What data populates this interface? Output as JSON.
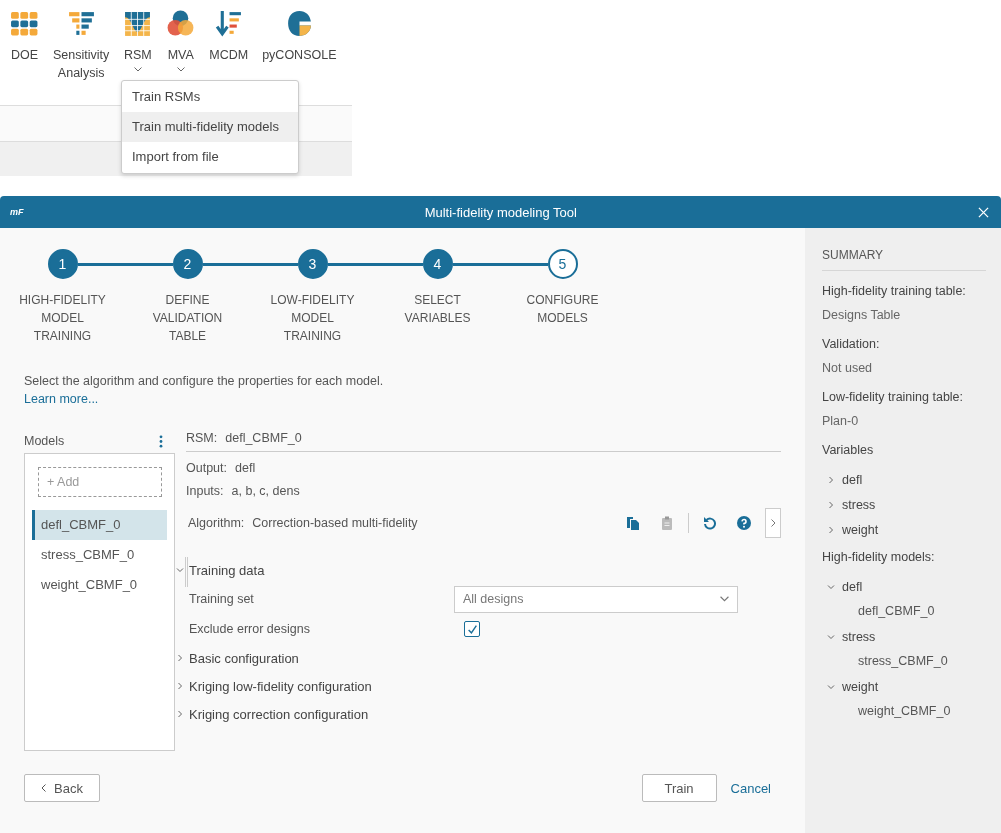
{
  "ribbon": {
    "items": [
      {
        "label": "DOE",
        "has_menu": false
      },
      {
        "label": "Sensitivity Analysis",
        "has_menu": false
      },
      {
        "label": "RSM",
        "has_menu": true
      },
      {
        "label": "MVA",
        "has_menu": true
      },
      {
        "label": "MCDM",
        "has_menu": false
      },
      {
        "label": "pyCONSOLE",
        "has_menu": false
      }
    ],
    "menu": [
      {
        "label": "Train RSMs",
        "selected": false
      },
      {
        "label": "Train multi-fidelity models",
        "selected": true
      },
      {
        "label": "Import from file",
        "selected": false
      }
    ]
  },
  "dialog": {
    "logo": "mF",
    "title": "Multi-fidelity modeling Tool",
    "steps": [
      {
        "number": "1",
        "label": "HIGH-FIDELITY MODEL TRAINING",
        "selected": false
      },
      {
        "number": "2",
        "label": "DEFINE VALIDATION TABLE",
        "selected": false
      },
      {
        "number": "3",
        "label": "LOW-FIDELITY MODEL TRAINING",
        "selected": false
      },
      {
        "number": "4",
        "label": "SELECT VARIABLES",
        "selected": false
      },
      {
        "number": "5",
        "label": "CONFIGURE MODELS",
        "selected": true
      }
    ],
    "description": "Select the algorithm and configure the properties for each model.",
    "learn_more": "Learn more...",
    "models": {
      "title": "Models",
      "add_label": "+ Add",
      "items": [
        {
          "name": "defl_CBMF_0",
          "selected": true
        },
        {
          "name": "stress_CBMF_0",
          "selected": false
        },
        {
          "name": "weight_CBMF_0",
          "selected": false
        }
      ]
    },
    "rsm": {
      "label": "RSM:",
      "value": "defl_CBMF_0"
    },
    "output": {
      "label": "Output:",
      "value": "defl"
    },
    "inputs": {
      "label": "Inputs:",
      "value": "a, b, c, dens"
    },
    "algorithm": {
      "label": "Algorithm:",
      "value": "Correction-based multi-fidelity"
    },
    "actions": [
      {
        "kind": "copy",
        "disabled": false
      },
      {
        "kind": "paste",
        "disabled": true
      },
      {
        "kind": "reset",
        "disabled": false
      },
      {
        "kind": "help",
        "disabled": false
      }
    ],
    "training_data": {
      "label": "Training data",
      "expanded": true,
      "training_set": {
        "label": "Training set",
        "value": "All designs"
      },
      "exclude_errors": {
        "label": "Exclude error designs",
        "checked": true
      }
    },
    "sections": [
      {
        "label": "Basic configuration",
        "expanded": false
      },
      {
        "label": "Kriging low-fidelity configuration",
        "expanded": false
      },
      {
        "label": "Kriging correction configuration",
        "expanded": false
      }
    ],
    "back": "Back",
    "train": "Train",
    "cancel": "Cancel",
    "summary": {
      "title": "SUMMARY",
      "fields": [
        {
          "label": "High-fidelity training table:",
          "value": "Designs Table"
        },
        {
          "label": "Validation:",
          "value": "Not used"
        },
        {
          "label": "Low-fidelity training table:",
          "value": "Plan-0"
        }
      ],
      "variables": {
        "label": "Variables",
        "items": [
          {
            "name": "defl",
            "expanded": false
          },
          {
            "name": "stress",
            "expanded": false
          },
          {
            "name": "weight",
            "expanded": false
          }
        ]
      },
      "models": {
        "label": "High-fidelity models:",
        "items": [
          {
            "name": "defl",
            "expanded": true,
            "children": [
              {
                "name": "defl_CBMF_0"
              }
            ]
          },
          {
            "name": "stress",
            "expanded": true,
            "children": [
              {
                "name": "stress_CBMF_0"
              }
            ]
          },
          {
            "name": "weight",
            "expanded": true,
            "children": [
              {
                "name": "weight_CBMF_0"
              }
            ]
          }
        ]
      }
    }
  }
}
